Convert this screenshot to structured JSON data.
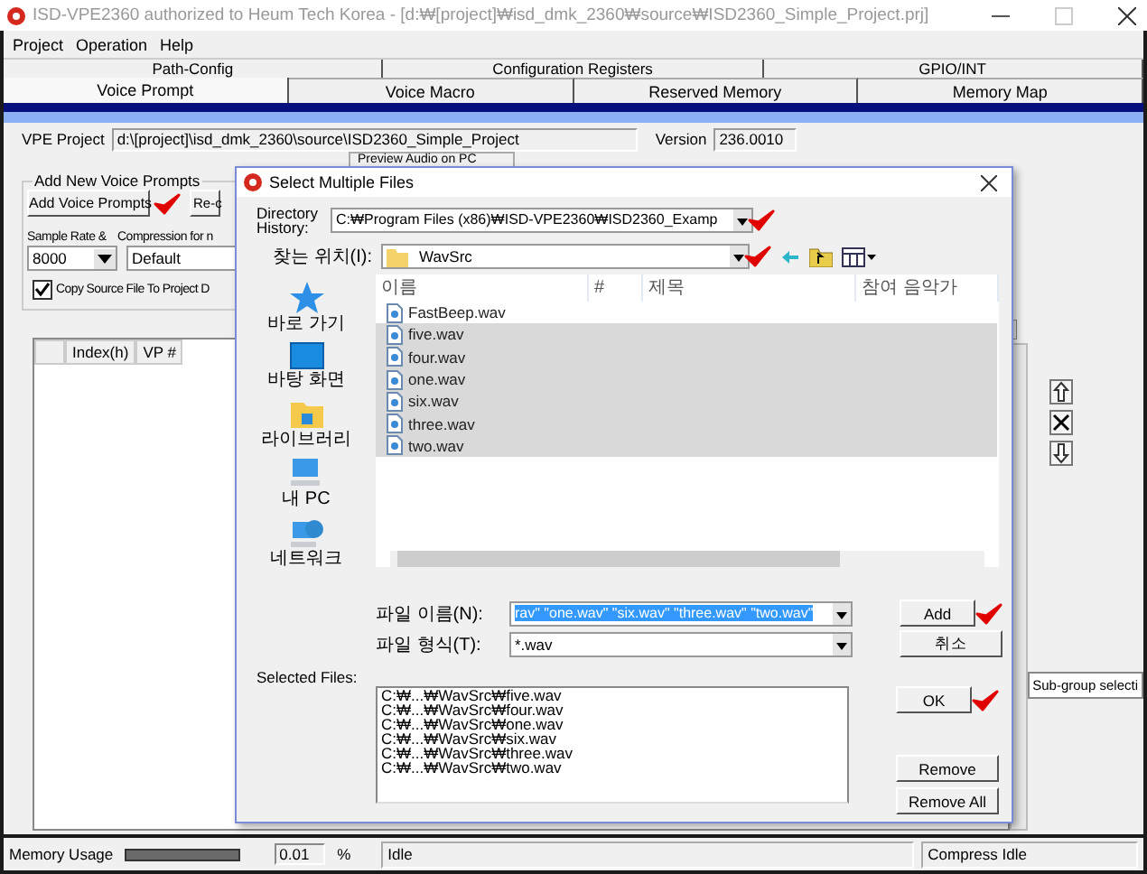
{
  "window": {
    "title": "ISD-VPE2360 authorized to Heum Tech Korea - [d:₩[project]₩isd_dmk_2360₩source₩ISD2360_Simple_Project.prj]"
  },
  "menu": [
    "Project",
    "Operation",
    "Help"
  ],
  "tabs_back": [
    {
      "label": "Path-Config",
      "selected": false
    },
    {
      "label": "Configuration Registers",
      "selected": false
    },
    {
      "label": "GPIO/INT",
      "selected": false
    }
  ],
  "tabs": [
    {
      "label": "Voice Prompt",
      "selected": true
    },
    {
      "label": "Voice Macro",
      "selected": false
    },
    {
      "label": "Reserved Memory",
      "selected": false
    },
    {
      "label": "Memory Map",
      "selected": false
    }
  ],
  "vpe_project": {
    "label": "VPE Project",
    "value": "d:\\[project]\\isd_dmk_2360\\source\\ISD2360_Simple_Project"
  },
  "version": {
    "label": "Version",
    "value": "236.0010"
  },
  "add_group": {
    "title": "Add New Voice Prompts",
    "preview_label": "Preview Audio on PC",
    "add_button": "Add Voice Prompts",
    "button_2": "Re-c",
    "sample_rate_label": "Sample Rate &",
    "compression_label": "Compression for n",
    "sample_rate": "8000",
    "compression": "Default",
    "copy_source": {
      "label": "Copy Source File To Project D",
      "checked": true
    }
  },
  "table": {
    "columns": [
      "Index(h)",
      "VP #"
    ]
  },
  "sub_group": {
    "value": "Sub-group selecti"
  },
  "status_bar": {
    "memory": {
      "label": "Memory Usage",
      "level": 0,
      "value": "0.01",
      "unit": "%"
    },
    "status": "Idle",
    "compress": "Compress Idle"
  },
  "dialog": {
    "title": "Select Multiple Files",
    "history_label": "Directory History:",
    "history": "C:₩Program Files (x86)₩ISD-VPE2360₩ISD2360_Examp",
    "location_label": "찾는 위치(I):",
    "location": "WavSrc",
    "places": [
      {
        "kind": "star",
        "label": "바로 가기"
      },
      {
        "kind": "desktop",
        "label": "바탕 화면"
      },
      {
        "kind": "library",
        "label": "라이브러리"
      },
      {
        "kind": "pc",
        "label": "내 PC"
      },
      {
        "kind": "network",
        "label": "네트워크"
      }
    ],
    "columns": [
      "이름",
      "#",
      "제목",
      "참여 음악가"
    ],
    "files": [
      {
        "name": "FastBeep.wav",
        "selected": false
      },
      {
        "name": "five.wav",
        "selected": true
      },
      {
        "name": "four.wav",
        "selected": true
      },
      {
        "name": "one.wav",
        "selected": true
      },
      {
        "name": "six.wav",
        "selected": true
      },
      {
        "name": "three.wav",
        "selected": true
      },
      {
        "name": "two.wav",
        "selected": true
      }
    ],
    "filename_label": "파일 이름(N):",
    "filename": "rav\" \"one.wav\" \"six.wav\" \"three.wav\" \"two.wav\"",
    "filetype_label": "파일 형식(T):",
    "filetype": "*.wav",
    "selected_label": "Selected Files:",
    "selected_files": [
      "C:₩...₩WavSrc₩five.wav",
      "C:₩...₩WavSrc₩four.wav",
      "C:₩...₩WavSrc₩one.wav",
      "C:₩...₩WavSrc₩six.wav",
      "C:₩...₩WavSrc₩three.wav",
      "C:₩...₩WavSrc₩two.wav"
    ],
    "buttons": {
      "add": "Add",
      "cancel": "취소",
      "ok": "OK",
      "remove": "Remove",
      "remove_all": "Remove All"
    }
  }
}
